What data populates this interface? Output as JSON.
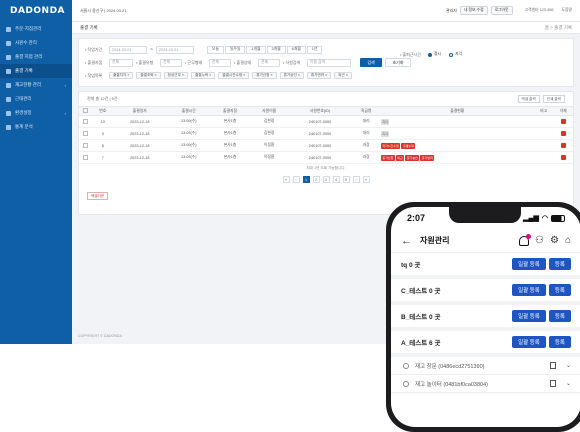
{
  "brand": "DADONDA",
  "topbar": {
    "org": "서울시 용산구 | 2024.03.21",
    "user": "관리자",
    "badge1": "내 정보 수정",
    "badge2": "로그아웃",
    "right1": "고객센터 123-456",
    "right2": "도움말"
  },
  "sidebar": {
    "items": [
      {
        "label": "주문·지점관리",
        "active": false,
        "arrow": ""
      },
      {
        "label": "사원수 관리",
        "active": false,
        "arrow": ""
      },
      {
        "label": "출결 지점 관리",
        "active": false,
        "arrow": ""
      },
      {
        "label": "출결 기록",
        "active": true,
        "arrow": ""
      },
      {
        "label": "재고현황 관리",
        "active": false,
        "arrow": "›"
      },
      {
        "label": "근태관리",
        "active": false,
        "arrow": ""
      },
      {
        "label": "환경설정",
        "active": false,
        "arrow": "›"
      },
      {
        "label": "통계 분석",
        "active": false,
        "arrow": ""
      }
    ]
  },
  "crumb": {
    "title": "출결 기록",
    "path": "홈 > 출결 기록"
  },
  "filter": {
    "row1": {
      "label": "• 작업기간",
      "from": "2024-03-01",
      "sep": "~",
      "to": "2024-03-21",
      "periods": [
        "오늘",
        "일주일",
        "1개월",
        "3개월",
        "6개월",
        "1년"
      ]
    },
    "row2": {
      "label": "• 출결지점",
      "v1": "전체",
      "label2": "• 출결유형",
      "v2": "전체",
      "label3": "• 근무형태",
      "v3": "전체",
      "label4": "• 출결상태",
      "v4": "전체",
      "label5": "• 사원검색",
      "search_placeholder": "이름 검색",
      "search": "검색",
      "reset": "초기화"
    },
    "radio": {
      "label": "• 출퇴근시간",
      "opt1": "정시",
      "opt2": "지각"
    },
    "row3": {
      "label": "• 작업목록",
      "chips": [
        "출결지각 ×",
        "출결조퇴 ×",
        "정상근무 ×",
        "출결누락 ×",
        "출결시간수정 ×",
        "휴가신청 ×",
        "휴가승인 ×",
        "휴가반려 ×",
        "외근 ×"
      ]
    }
  },
  "list": {
    "summary": "전체 총 12건 | 5건",
    "btn_excel": "엑셀 출력",
    "btn_print": "인쇄 출력",
    "columns": [
      "",
      "번호",
      "출결일자",
      "출결시간",
      "출결지점",
      "사원이름",
      "사원번호(ID)",
      "직급명",
      "출결현황",
      "비고",
      "삭제"
    ],
    "rows": [
      {
        "no": "10",
        "date": "2023-12-18",
        "time": "13:09(수)",
        "place": "본사1층",
        "name": "김현정",
        "id": "240107-0000",
        "rank": "대리",
        "tags": [
          {
            "t": "지각",
            "c": "gray"
          }
        ]
      },
      {
        "no": "9",
        "date": "2023-12-18",
        "time": "13:09(수)",
        "place": "본사1층",
        "name": "김현정",
        "id": "240107-0000",
        "rank": "대리",
        "tags": [
          {
            "t": "지각",
            "c": "gray"
          }
        ]
      },
      {
        "no": "8",
        "date": "2023-12-18",
        "time": "13:09(수)",
        "place": "본사1층",
        "name": "이정환",
        "id": "240107-0000",
        "rank": "과장",
        "tags": [
          {
            "t": "지각시간수정",
            "c": "red"
          },
          {
            "t": "출결누락",
            "c": "red"
          }
        ]
      },
      {
        "no": "7",
        "date": "2023-12-18",
        "time": "13:09(수)",
        "place": "본사1층",
        "name": "이정환",
        "id": "240107-0000",
        "rank": "과장",
        "tags": [
          {
            "t": "휴가신청",
            "c": "red"
          },
          {
            "t": "외근",
            "c": "red"
          },
          {
            "t": "휴가승인",
            "c": "red"
          },
          {
            "t": "휴가반려",
            "c": "red"
          }
        ]
      }
    ],
    "notice": "최대 1년 조회 가능합니다.",
    "pages": [
      "«",
      "‹",
      "1",
      "2",
      "3",
      "4",
      "5",
      "›",
      "»"
    ],
    "active_page": "1",
    "excel_btn": "엑셀다운"
  },
  "footer": "COPYRIGHT © DADONDA",
  "phone": {
    "time": "2:07",
    "title": "자원관리",
    "groups": [
      {
        "name": "tq 0 곳",
        "btn1": "일괄 등록",
        "btn2": "등록"
      },
      {
        "name": "C_테스트 0 곳",
        "btn1": "일괄 등록",
        "btn2": "등록"
      },
      {
        "name": "B_테스트 0 곳",
        "btn1": "일괄 등록",
        "btn2": "등록"
      },
      {
        "name": "A_테스트 6 곳",
        "btn1": "일괄 등록",
        "btn2": "등록"
      }
    ],
    "items": [
      "재고 창문 (0486ecd2751390)",
      "재고 놀이터 (0481bf0ca03804)"
    ]
  }
}
